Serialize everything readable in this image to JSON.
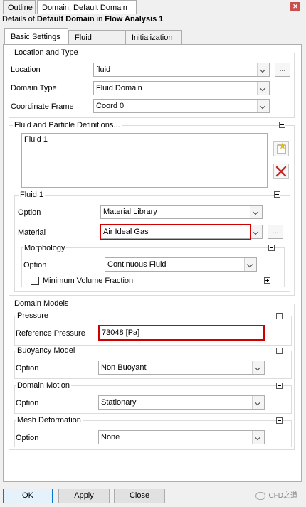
{
  "top_tabs": [
    {
      "label": "Outline"
    },
    {
      "label": "Domain: Default Domain"
    }
  ],
  "details": {
    "prefix": "Details of ",
    "domain": "Default Domain",
    "middle": " in ",
    "analysis": "Flow Analysis 1"
  },
  "sub_tabs": [
    {
      "label": "Basic Settings"
    },
    {
      "label": "Fluid Models"
    },
    {
      "label": "Initialization"
    }
  ],
  "location_type": {
    "title": "Location and Type",
    "location_label": "Location",
    "location_value": "fluid",
    "dots_label": "...",
    "domain_type_label": "Domain Type",
    "domain_type_value": "Fluid Domain",
    "coord_label": "Coordinate Frame",
    "coord_value": "Coord 0"
  },
  "fluid_defs": {
    "title": "Fluid and Particle Definitions...",
    "items": [
      "Fluid 1"
    ]
  },
  "fluid1": {
    "title": "Fluid 1",
    "option_label": "Option",
    "option_value": "Material Library",
    "material_label": "Material",
    "material_value": "Air Ideal Gas",
    "dots_label": "...",
    "morphology": {
      "title": "Morphology",
      "option_label": "Option",
      "option_value": "Continuous Fluid",
      "min_vol_label": "Minimum Volume Fraction"
    }
  },
  "domain_models": {
    "title": "Domain Models",
    "pressure": {
      "title": "Pressure",
      "ref_label": "Reference Pressure",
      "ref_value": "73048 [Pa]"
    },
    "buoyancy": {
      "title": "Buoyancy Model",
      "option_label": "Option",
      "option_value": "Non Buoyant"
    },
    "motion": {
      "title": "Domain Motion",
      "option_label": "Option",
      "option_value": "Stationary"
    },
    "mesh_def": {
      "title": "Mesh Deformation",
      "option_label": "Option",
      "option_value": "None"
    }
  },
  "buttons": {
    "ok": "OK",
    "apply": "Apply",
    "close": "Close"
  },
  "watermark": "CFD之道",
  "colors": {
    "highlight": "#d00000",
    "ok_border": "#0078d7"
  }
}
